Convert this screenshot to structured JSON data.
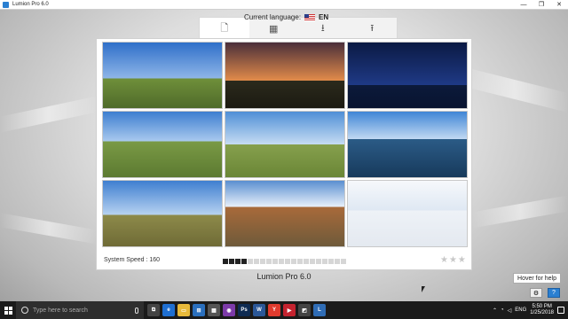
{
  "window": {
    "title": "Lumion Pro 6.0",
    "controls": [
      "—",
      "❐",
      "✕"
    ]
  },
  "language": {
    "label": "Current language:",
    "code": "EN"
  },
  "tabs": [
    {
      "name": "tab-new-scene",
      "icon": "document-icon",
      "glyph": "🗋",
      "active": true
    },
    {
      "name": "tab-examples",
      "icon": "building-icon",
      "glyph": "▦",
      "active": false
    },
    {
      "name": "tab-load",
      "icon": "load-icon",
      "glyph": "⭳",
      "active": false
    },
    {
      "name": "tab-save",
      "icon": "save-icon",
      "glyph": "⭱",
      "active": false
    }
  ],
  "thumbnails": [
    {
      "name": "grassland-day",
      "sky": [
        "#2f6fc9",
        "#8fb6e8"
      ],
      "ground": [
        "#6f8f3a",
        "#4f6b2a"
      ],
      "horizon": 55
    },
    {
      "name": "sunset-plain",
      "sky": [
        "#4a2f3a",
        "#e28b4a"
      ],
      "ground": [
        "#2b2a1c",
        "#1c1a12"
      ],
      "horizon": 58
    },
    {
      "name": "night-ocean",
      "sky": [
        "#0b1a44",
        "#1f3a86"
      ],
      "ground": [
        "#0c1a3a",
        "#081330"
      ],
      "horizon": 65
    },
    {
      "name": "hills-grass",
      "sky": [
        "#3d7ed0",
        "#a9c9ee"
      ],
      "ground": [
        "#7a9a45",
        "#5c7a31"
      ],
      "horizon": 45
    },
    {
      "name": "mountain-plain",
      "sky": [
        "#4f8fd6",
        "#c6dcf3"
      ],
      "ground": [
        "#86a04d",
        "#6a8636"
      ],
      "horizon": 50
    },
    {
      "name": "mountain-lake",
      "sky": [
        "#3f86d6",
        "#c2d9f2"
      ],
      "ground": [
        "#2b5b86",
        "#173a5c"
      ],
      "horizon": 42
    },
    {
      "name": "desert-plain",
      "sky": [
        "#3f7fd0",
        "#b7d2f1"
      ],
      "ground": [
        "#8d8a4a",
        "#6f6b36"
      ],
      "horizon": 52
    },
    {
      "name": "canyon-water",
      "sky": [
        "#5a8fd0",
        "#e9f1fb"
      ],
      "ground": [
        "#a86a3a",
        "#6e5a3a"
      ],
      "horizon": 40
    },
    {
      "name": "blank-scene",
      "sky": [
        "#f6f8fb",
        "#dfe8f3"
      ],
      "ground": [
        "#eef2f7",
        "#e4e9f0"
      ],
      "horizon": 45
    }
  ],
  "status": {
    "speed_label": "System Speed :",
    "speed_value": "160",
    "meter_total": 20,
    "meter_filled": 4,
    "stars": "★★★"
  },
  "product_name": "Lumion Pro 6.0",
  "help": {
    "tooltip": "Hover for help",
    "settings_glyph": "⚙",
    "help_glyph": "?"
  },
  "taskbar": {
    "search_placeholder": "Type here to search",
    "apps": [
      {
        "name": "task-view-icon",
        "color": "#444",
        "glyph": "⧉"
      },
      {
        "name": "edge-icon",
        "color": "#1f6fd1",
        "glyph": "e"
      },
      {
        "name": "explorer-icon",
        "color": "#e7b93a",
        "glyph": "▭"
      },
      {
        "name": "store-icon",
        "color": "#2a6fbd",
        "glyph": "⊞"
      },
      {
        "name": "calculator-icon",
        "color": "#555",
        "glyph": "▦"
      },
      {
        "name": "photo-viewer-icon",
        "color": "#7c3aa8",
        "glyph": "◉"
      },
      {
        "name": "photoshop-icon",
        "color": "#0f2b52",
        "glyph": "Ps"
      },
      {
        "name": "word-icon",
        "color": "#2b5797",
        "glyph": "W"
      },
      {
        "name": "yandex-icon",
        "color": "#e03b2e",
        "glyph": "Y"
      },
      {
        "name": "media-icon",
        "color": "#c4232f",
        "glyph": "▶"
      },
      {
        "name": "sketchup-icon",
        "color": "#444",
        "glyph": "◩"
      },
      {
        "name": "lumion-icon",
        "color": "#2f6cb5",
        "glyph": "L"
      }
    ],
    "lang": "ENG",
    "time": "5:50 PM",
    "date": "1/25/2018"
  }
}
